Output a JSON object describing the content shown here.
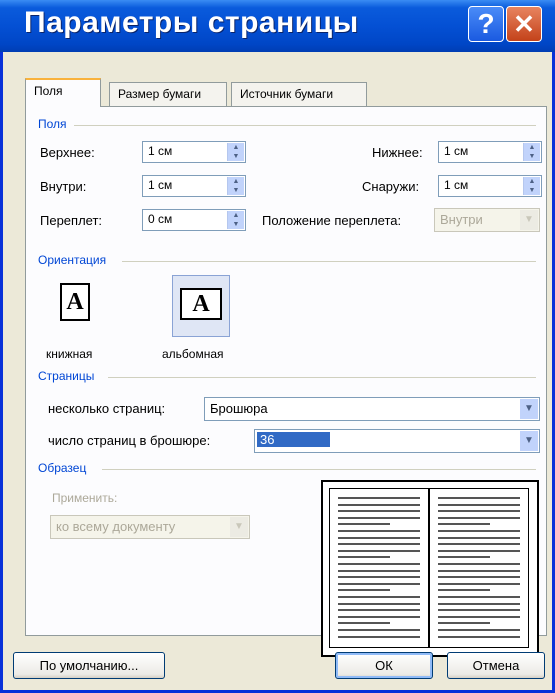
{
  "window": {
    "title": "Параметры страницы",
    "help_glyph": "?",
    "close_glyph": "✕"
  },
  "tabs": [
    {
      "label": "Поля",
      "active": true
    },
    {
      "label": "Размер бумаги",
      "active": false
    },
    {
      "label": "Источник бумаги",
      "active": false
    }
  ],
  "margins": {
    "group_label": "Поля",
    "top_label": "Верхнее:",
    "top_value": "1 см",
    "bottom_label": "Нижнее:",
    "bottom_value": "1 см",
    "inside_label": "Внутри:",
    "inside_value": "1 см",
    "outside_label": "Снаружи:",
    "outside_value": "1 см",
    "gutter_label": "Переплет:",
    "gutter_value": "0 см",
    "gutter_pos_label": "Положение переплета:",
    "gutter_pos_value": "Внутри"
  },
  "orientation": {
    "group_label": "Ориентация",
    "portrait_label": "книжная",
    "landscape_label": "альбомная",
    "glyph": "A",
    "selected": "landscape"
  },
  "pages": {
    "group_label": "Страницы",
    "multiple_label": "несколько страниц:",
    "multiple_value": "Брошюра",
    "per_booklet_label": "число страниц в брошюре:",
    "per_booklet_value": "36"
  },
  "sample": {
    "group_label": "Образец",
    "apply_label": "Применить:",
    "apply_value": "ко всему документу"
  },
  "buttons": {
    "default": "По умолчанию...",
    "ok": "ОК",
    "cancel": "Отмена"
  },
  "colors": {
    "title_bar": "#0450D4",
    "dialog_bg": "#ECE9D8",
    "group_label": "#0046D5",
    "selection": "#316AC5",
    "active_tab_accent": "#F9B23C"
  }
}
